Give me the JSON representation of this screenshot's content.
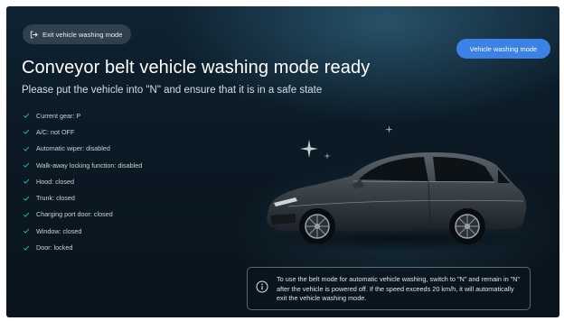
{
  "header": {
    "exit_label": "Exit vehicle washing mode",
    "mode_label": "Vehicle washing mode"
  },
  "main": {
    "title": "Conveyor belt vehicle washing mode ready",
    "subtitle": "Please put the vehicle into \"N\" and ensure that it is in a safe state",
    "checklist": [
      "Current gear: P",
      "A/C: not OFF",
      "Automatic wiper: disabled",
      "Walk-away locking function: disabled",
      "Hood: closed",
      "Trunk: closed",
      "Charging port door: closed",
      "Window: closed",
      "Door: locked"
    ]
  },
  "notice": {
    "text": "To use the belt mode for automatic vehicle washing, switch to \"N\" and remain in \"N\" after the vehicle is powered off. If the speed exceeds 20 km/h, it will automatically exit the vehicle washing mode."
  },
  "colors": {
    "accent": "#3a82e6",
    "check": "#2fb9a7",
    "background": "#0b1a25"
  },
  "icons": {
    "exit": "exit-icon",
    "check": "check-icon",
    "info": "info-icon",
    "sparkle": "sparkle-icon"
  }
}
